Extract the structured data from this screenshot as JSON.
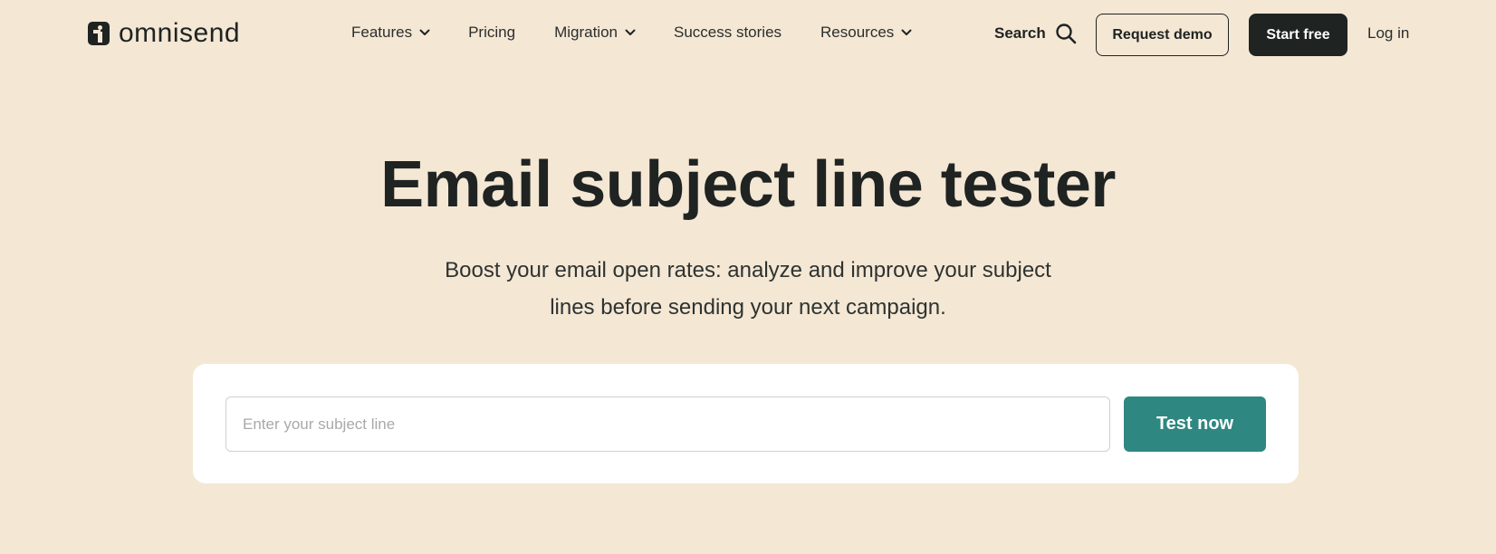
{
  "brand": {
    "name": "omnisend",
    "logo_icon": "omnisend-logo-icon"
  },
  "nav": {
    "items": [
      {
        "label": "Features",
        "has_dropdown": true
      },
      {
        "label": "Pricing",
        "has_dropdown": false
      },
      {
        "label": "Migration",
        "has_dropdown": true
      },
      {
        "label": "Success stories",
        "has_dropdown": false
      },
      {
        "label": "Resources",
        "has_dropdown": true
      }
    ],
    "search_label": "Search",
    "request_demo_label": "Request demo",
    "start_free_label": "Start free",
    "login_label": "Log in"
  },
  "hero": {
    "title": "Email subject line tester",
    "subtitle_line1": "Boost your email open rates: analyze and improve your subject",
    "subtitle_line2": "lines before sending your next campaign."
  },
  "tester": {
    "placeholder": "Enter your subject line",
    "value": "",
    "button_label": "Test now"
  },
  "colors": {
    "background": "#f4e7d4",
    "text_dark": "#1f2322",
    "accent": "#2e8780",
    "card": "#ffffff"
  }
}
